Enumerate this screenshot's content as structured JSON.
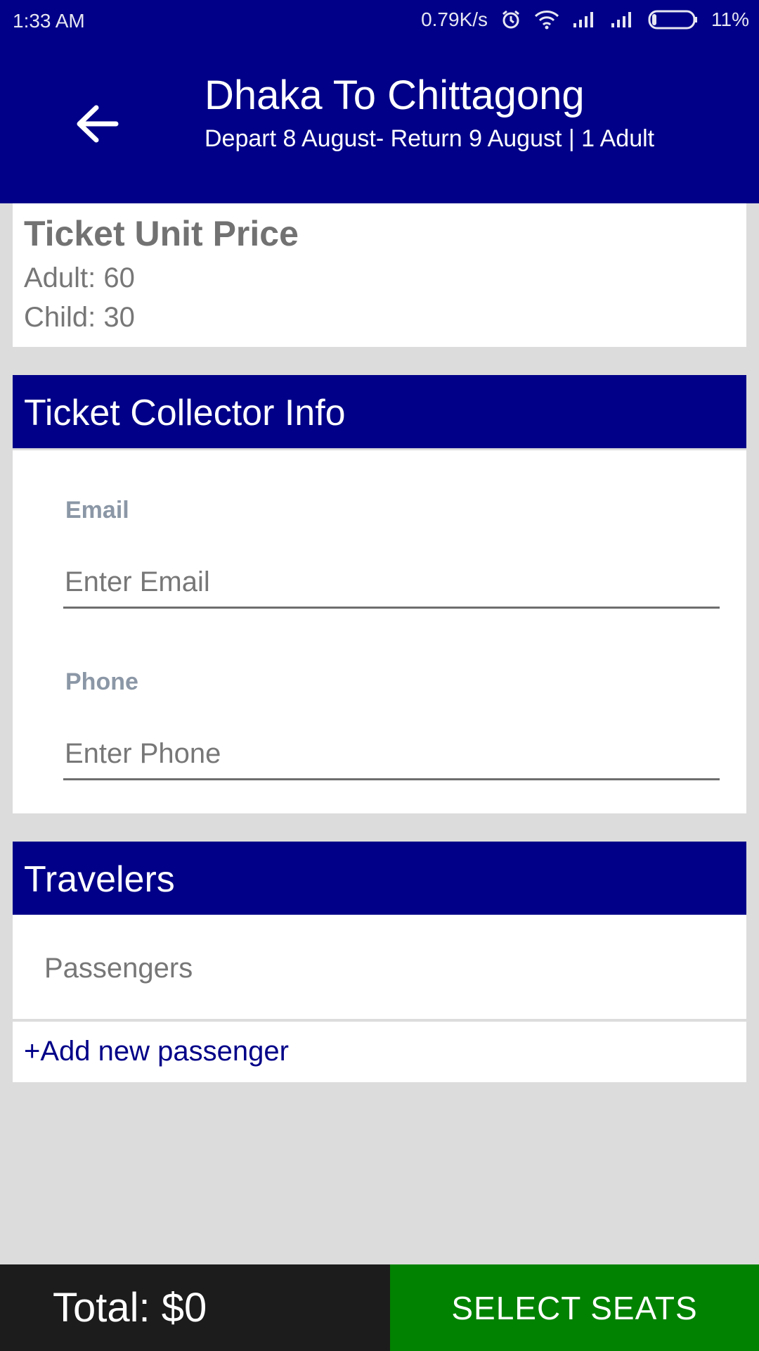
{
  "status_bar": {
    "time": "1:33 AM",
    "network_speed": "0.79K/s",
    "battery_percent": "11%",
    "icons": [
      "alarm-icon",
      "wifi-icon",
      "signal-icon",
      "signal-icon",
      "battery-icon"
    ]
  },
  "app_bar": {
    "title": "Dhaka To Chittagong",
    "subtitle": "Depart 8 August- Return 9 August | 1 Adult",
    "back_icon": "arrow-left-icon"
  },
  "price": {
    "title": "Ticket Unit Price",
    "adult": "Adult: 60",
    "child": "Child: 30"
  },
  "collector": {
    "header": "Ticket Collector Info",
    "email_label": "Email",
    "email_placeholder": "Enter Email",
    "email_value": "",
    "phone_label": "Phone",
    "phone_placeholder": "Enter Phone",
    "phone_value": ""
  },
  "travelers": {
    "header": "Travelers",
    "passengers_label": "Passengers",
    "add_label": "+Add new passenger"
  },
  "footer": {
    "total": "Total: $0",
    "select_button": "SELECT SEATS"
  },
  "colors": {
    "primary": "#000088",
    "success": "#018201",
    "dark": "#1c1c1c"
  }
}
